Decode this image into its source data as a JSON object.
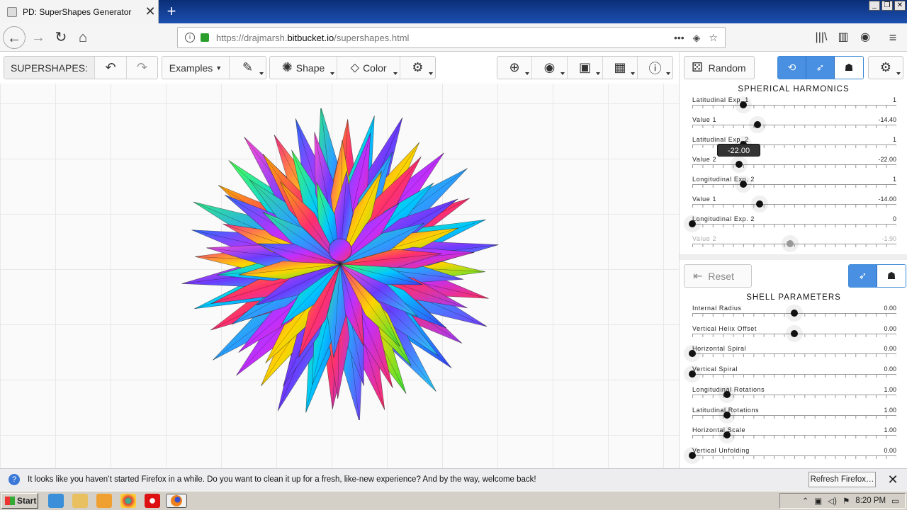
{
  "browser": {
    "tab_title": "PD: SuperShapes Generator",
    "url_prefix": "https://drajmarsh.",
    "url_domain": "bitbucket.io",
    "url_path": "/supershapes.html"
  },
  "toolbar": {
    "app_label": "SUPERSHAPES:",
    "examples_label": "Examples",
    "shape_label": "Shape",
    "color_label": "Color"
  },
  "right_panel": {
    "random_label": "Random",
    "spherical_title": "SPHERICAL HARMONICS",
    "reset_label": "Reset",
    "shell_title": "SHELL PARAMETERS",
    "tooltip_value": "-22.00",
    "spherical_sliders": [
      {
        "label": "Latitudinal Exp. 1",
        "value": "1",
        "pos": 0.25
      },
      {
        "label": "Value 1",
        "value": "-14.40",
        "pos": 0.32
      },
      {
        "label": "Latitudinal Exp. 2",
        "value": "1",
        "pos": 0.25
      },
      {
        "label": "Value 2",
        "value": "-22.00",
        "pos": 0.23
      },
      {
        "label": "Longitudinal Exp. 2",
        "value": "1",
        "pos": 0.25
      },
      {
        "label": "Value 1",
        "value": "-14.00",
        "pos": 0.33
      },
      {
        "label": "Longitudinal Exp. 2",
        "value": "0",
        "pos": 0.0
      },
      {
        "label": "Value 2",
        "value": "-1.90",
        "pos": 0.48
      }
    ],
    "shell_sliders": [
      {
        "label": "Internal Radius",
        "value": "0.00",
        "pos": 0.5
      },
      {
        "label": "Vertical Helix Offset",
        "value": "0.00",
        "pos": 0.5
      },
      {
        "label": "Horizontal Spiral",
        "value": "0.00",
        "pos": 0.0
      },
      {
        "label": "Vertical Spiral",
        "value": "0.00",
        "pos": 0.0
      },
      {
        "label": "Longitudinal Rotations",
        "value": "1.00",
        "pos": 0.17
      },
      {
        "label": "Latitudinal Rotations",
        "value": "1.00",
        "pos": 0.17
      },
      {
        "label": "Horizontal Scale",
        "value": "1.00",
        "pos": 0.17
      },
      {
        "label": "Vertical Unfolding",
        "value": "0.00",
        "pos": 0.0
      }
    ]
  },
  "notification": {
    "message": "It looks like you haven’t started Firefox in a while. Do you want to clean it up for a fresh, like-new experience? And by the way, welcome back!",
    "button_label": "Refresh Firefox…"
  },
  "taskbar": {
    "start_label": "Start",
    "clock": "8:20 PM"
  }
}
